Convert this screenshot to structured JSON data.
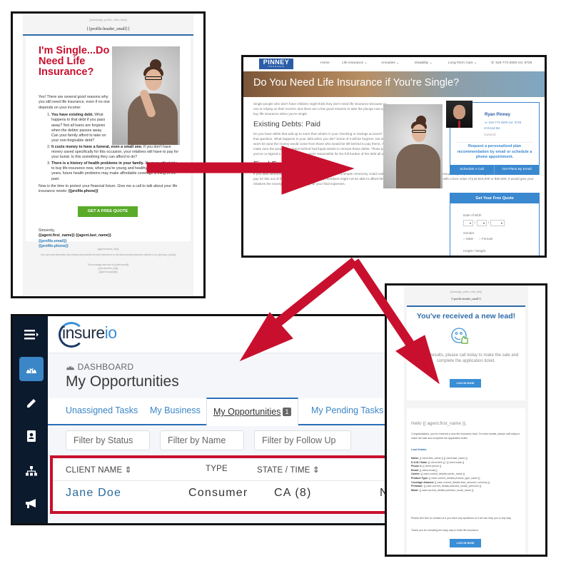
{
  "email_template": {
    "meta_tag": "{{message_public_view_link}}",
    "header": "{{profile.header_small}}",
    "title": "I'm Single...Do I Need Life Insurance?",
    "intro": "Yes! There are several good reasons why you still need life insurance, even if no one depends on your income:",
    "reasons": [
      {
        "bold": "You have existing debt.",
        "text": " What happens to that debt if you pass away? Not all loans are forgiven when the debtor passes away. Can your family afford to take on your non-forgivable debt?"
      },
      {
        "bold": "It costs money to have a funeral, even a small one.",
        "text": " If you don't have money saved specifically for this occasion, your relatives will have to pay for your burial. Is this something they can afford to do?"
      },
      {
        "bold": "There is a history of health problems in your family.",
        "text": " It's more affordable to buy life insurance now, when you're young and healthy. If you wait 10 or 20 years, future health problems may make affordable coverage a thing of the past."
      }
    ],
    "outro": "Now is the time to protect your financial future. Give me a call to talk about your life insurance needs: ",
    "outro_phone": "{{profile.phone}}",
    "cta_label": "GET A FREE QUOTE",
    "sign_off": "Sincerely,",
    "agent_name": "{{agent.first_name}} {{agent.last_name}}",
    "agent_email": "{{profile.email}}",
    "agent_phone": "{{profile.phone}}",
    "footer": {
      "license": "{{agent.license_info}}",
      "privacy": "Your personal information and privacy are protected by strict adherence to the data security measures outlined in our {{privacy_policy}}",
      "sent_to": "This message was sent to {{client.email}}",
      "unsubscribe": "{{unsubscribe_link}}",
      "copyright": "{{agent.copyright}}"
    }
  },
  "website": {
    "logo_main": "PINNEY",
    "logo_sub": "INSURANCE",
    "nav": [
      "Home",
      "Life Insurance ⌄",
      "Annuities ⌄",
      "Disability ⌄",
      "Long-Term Care ⌄",
      "☏ 916-773-2800 ext. 8728"
    ],
    "banner_title": "Do You Need Life Insurance if You're Single?",
    "intro": "Single people who don't have children might think they don't need life insurance because no one is relying on their income. But there are a few good reasons to take the plunge now and buy life insurance when you're single.",
    "section1_title": "Existing Debts: Paid",
    "section1_text": "Do you have debts that add up to more than what's in your checking or savings account? Most of us will answer yes to that question. What happens to your debt when you die? Some of it will be forgiven, but some debts, like student loans, won't be (and the money would come from those who would be left behind to pay them). A life insurance policy would make sure the people you leave behind had liquid assets to remove those debts. Those proceeds can also go to anyone you've co-signed a loan with, so they aren't responsible for the full burden of the debt all alone.",
    "section2_title": "Final Expenses: Paid",
    "section2_text": "If you died tomorrow, who would pay for your funeral? Even a simple ceremony could cost a couple thousand dollars. Without life insurance, your parents, siblings, or other relatives would have to pay for this out of their own pockets. Some family members might not be able to afford this. If you had a small life insurance policy, with a face value of just $10,000 or $20,000, it would give your relatives the money they needed to pay for your final expenses.",
    "agent": {
      "name": "Ryan Pinney",
      "phone": "☏ 916-773-2800 ext. 8728",
      "email": "✉ Email Me",
      "connect": "Connect:",
      "request": "Request a personalized plan recommendation by email or schedule a phone appointment.",
      "btn_call": "Schedule A Call",
      "btn_email": "Get Plans By Email"
    },
    "quote": {
      "title": "Get Your Free Quote",
      "dob_label": "Date of Birth",
      "dob_sep": "/",
      "gender_label": "Gender",
      "gender_options": [
        "Male",
        "Female"
      ],
      "hw_label": "Height / Weight",
      "dropdown_arrow": "▾"
    }
  },
  "dashboard": {
    "brand_prefix": "insure",
    "brand_suffix": "io",
    "sidebar_icons": [
      "menu-icon",
      "dashboard-icon",
      "pencil-icon",
      "contacts-icon",
      "org-chart-icon",
      "megaphone-icon"
    ],
    "breadcrumb": "DASHBOARD",
    "page_title": "My Opportunities",
    "tabs": [
      {
        "label": "Unassigned Tasks"
      },
      {
        "label": "My Business"
      },
      {
        "label": "My Opportunities",
        "badge": "1",
        "active": true
      },
      {
        "label": "My Pending Tasks"
      }
    ],
    "filters": [
      "Filter by Status",
      "Filter by Name",
      "Filter by Follow Up"
    ],
    "table": {
      "columns": [
        "CLIENT NAME ⇕",
        "TYPE",
        "STATE / TIME ⇕"
      ],
      "rows": [
        {
          "client": "Jane Doe",
          "type": "Consumer",
          "state": "CA (8)",
          "next": "N"
        }
      ]
    }
  },
  "lead_email": {
    "meta_tag": "{{message_public_view_link}}",
    "header": "{{profile.header_small}}",
    "title": "You've received a new lead!",
    "summary": "For best results, please call today to make the sale and complete the application ticket.",
    "login_label": "LOG IN NOW",
    "hello": "Hello {{ agent.first_name }},",
    "congrats": "Congratulations, you've received a new life insurance lead. For best results, please call today to make the sale and complete the application ticket.",
    "details_title": "Lead Details:",
    "details": [
      {
        "k": "Name:",
        "v": " {{ client.first_name }} {{ client.last_name }}"
      },
      {
        "k": "D.O.B./ State:",
        "v": " {{ client.birth }} / {{ client.state }}"
      },
      {
        "k": "Phone #:",
        "v": " {{ client.phone }}"
      },
      {
        "k": "Email:",
        "v": " {{ client.email }}"
      },
      {
        "k": "Carrier:",
        "v": " {{ case.current_details.carrier_name }}"
      },
      {
        "k": "Product Type:",
        "v": " {{ case.current_details.product_type_name }}"
      },
      {
        "k": "Coverage Amount:",
        "v": " {{ case.current_details.face_amount | currency }}"
      },
      {
        "k": "Premium:",
        "v": " {{ case.current_details.planned_modal_premium }}"
      },
      {
        "k": "Mode:",
        "v": " {{ case.current_details.premium_mode_name }}"
      }
    ],
    "contact": "Please feel free to contact us if you have any questions or if we can help you in any way.",
    "thanks": "Thank you for choosing the easy way to write life insurance."
  },
  "colors": {
    "arrow": "#c8102e",
    "brand_blue": "#3a8ed6",
    "email_red": "#c8102e",
    "cta_green": "#5aab2a",
    "sidebar_dark": "#0c1a2e"
  }
}
